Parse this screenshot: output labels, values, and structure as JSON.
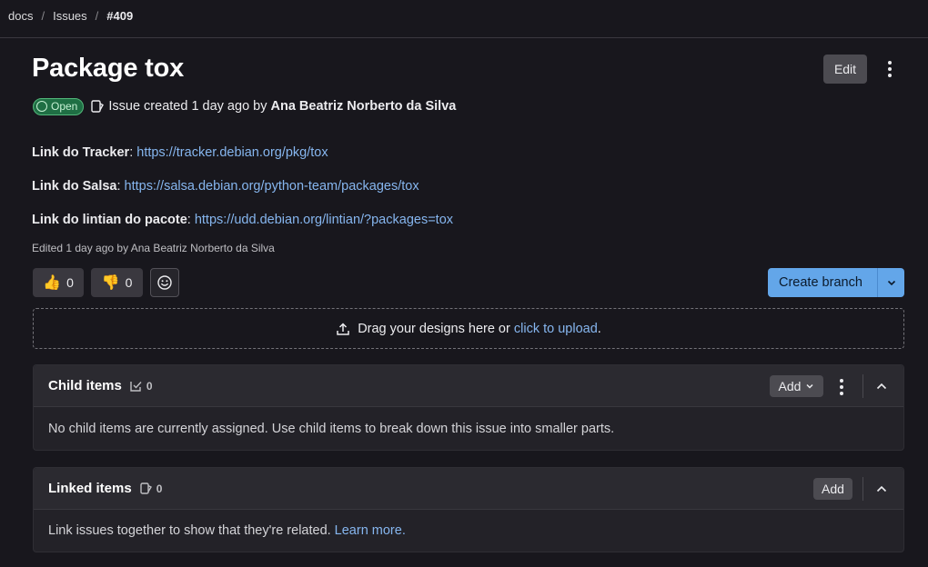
{
  "breadcrumb": {
    "items": [
      "docs",
      "Issues"
    ],
    "current": "#409",
    "separator": "/"
  },
  "issue": {
    "title": "Package tox",
    "status": "Open",
    "created_text": "Issue created 1 day ago by",
    "author": "Ana Beatriz Norberto da Silva",
    "edited_text": "Edited 1 day ago by Ana Beatriz Norberto da Silva"
  },
  "header": {
    "edit_label": "Edit"
  },
  "description": [
    {
      "label": "Link do Tracker",
      "url": "https://tracker.debian.org/pkg/tox"
    },
    {
      "label": "Link do Salsa",
      "url": "https://salsa.debian.org/python-team/packages/tox"
    },
    {
      "label": "Link do lintian do pacote",
      "url": "https://udd.debian.org/lintian/?packages=tox"
    }
  ],
  "reactions": {
    "thumbs_up": {
      "emoji": "👍",
      "count": "0"
    },
    "thumbs_down": {
      "emoji": "👎",
      "count": "0"
    }
  },
  "create_branch": {
    "label": "Create branch"
  },
  "dropzone": {
    "text": "Drag your designs here or",
    "link": "click to upload",
    "suffix": "."
  },
  "child_items": {
    "title": "Child items",
    "count": "0",
    "add_label": "Add",
    "empty_text": "No child items are currently assigned. Use child items to break down this issue into smaller parts."
  },
  "linked_items": {
    "title": "Linked items",
    "count": "0",
    "add_label": "Add",
    "empty_text": "Link issues together to show that they're related.",
    "learn_more": "Learn more."
  },
  "colors": {
    "background": "#18171d",
    "link": "#86b6ef",
    "primary_button": "#63a6e9",
    "status_open": "#1f6f44"
  }
}
